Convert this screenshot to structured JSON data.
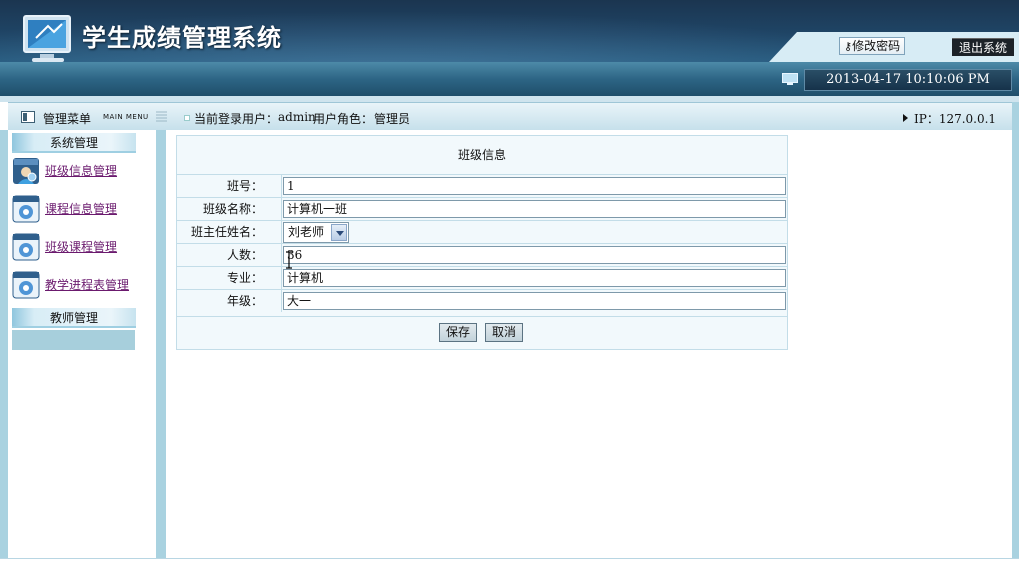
{
  "header": {
    "title": "学生成绩管理系统",
    "change_password": "修改密码",
    "logout": "退出系统",
    "datetime": "2013-04-17 10:10:06 PM"
  },
  "menubar": {
    "menu_title": "管理菜单",
    "menu_subtitle": "MAIN MENU",
    "user_label": "当前登录用户：",
    "user_name": "admin",
    "role_label": "用户角色：",
    "role_value": "管理员",
    "ip": "IP：127.0.0.1"
  },
  "sidebar": {
    "groups": [
      {
        "title": "系统管理",
        "items": [
          {
            "label": "班级信息管理",
            "icon": "users-settings-icon"
          },
          {
            "label": "课程信息管理",
            "icon": "gear-window-icon"
          },
          {
            "label": "班级课程管理",
            "icon": "gear-window-icon"
          },
          {
            "label": "教学进程表管理",
            "icon": "gear-window-icon"
          }
        ]
      },
      {
        "title": "教师管理",
        "items": []
      }
    ]
  },
  "form": {
    "title": "班级信息",
    "fields": [
      {
        "label": "班号：",
        "value": "1"
      },
      {
        "label": "班级名称：",
        "value": "计算机一班"
      },
      {
        "label": "班主任姓名：",
        "value": "刘老师"
      },
      {
        "label": "人数：",
        "value": "36"
      },
      {
        "label": "专业：",
        "value": "计算机"
      },
      {
        "label": "年级：",
        "value": "大一"
      }
    ],
    "save": "保存",
    "cancel": "取消"
  },
  "colors": {
    "header_dark": "#1b3550",
    "rail": "#a9d2e0",
    "link": "#6b1a6e",
    "panel_bg": "#f2f9fc"
  }
}
